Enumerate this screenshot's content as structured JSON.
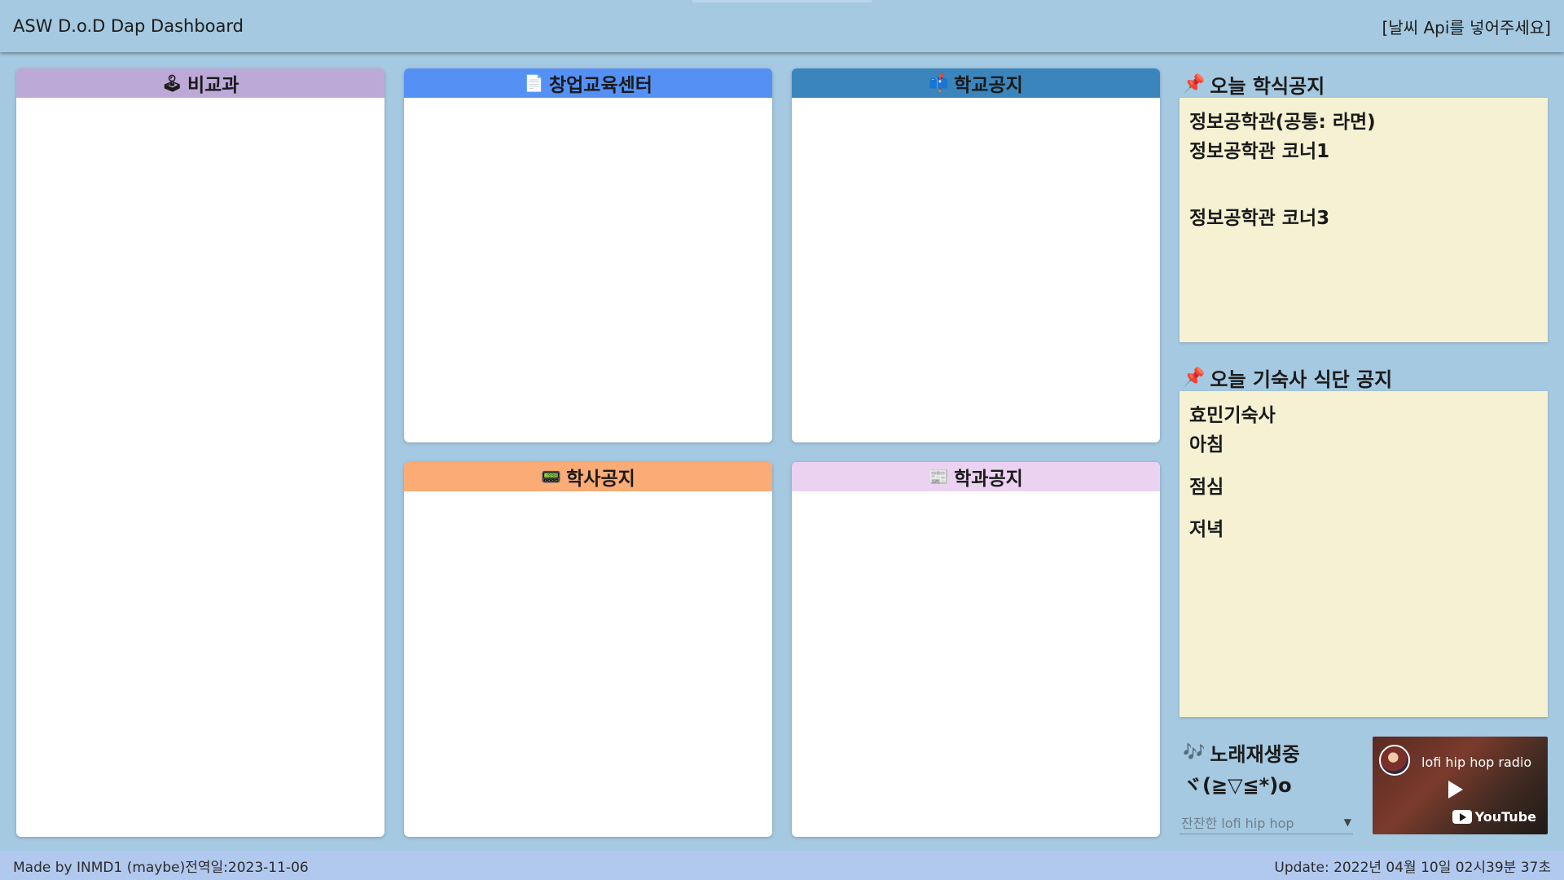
{
  "header": {
    "title": "ASW D.o.D Dap Dashboard",
    "weather": "[날씨 Api를 넣어주세요]"
  },
  "panels": {
    "bigyo": {
      "icon": "🕹",
      "label": "비교과",
      "color": "#bda9d8"
    },
    "startup": {
      "icon": "📄",
      "label": "창업교육센터",
      "color": "#5591f5"
    },
    "school": {
      "icon": "📫",
      "label": "학교공지",
      "color": "#3a86bc"
    },
    "haksa": {
      "icon": "📟",
      "label": "학사공지",
      "color": "#fbab75"
    },
    "dept": {
      "icon": "📰",
      "label": "학과공지",
      "color": "#ebd2f1"
    }
  },
  "cafeteria": {
    "title": "오늘 학식공지",
    "lines": [
      "정보공학관(공통: 라면)",
      "정보공학관 코너1",
      "정보공학관 코너3"
    ]
  },
  "dorm": {
    "title": "오늘 기숙사 식단 공지",
    "lines": [
      "효민기숙사",
      "아침",
      "점심",
      "저녁"
    ]
  },
  "music": {
    "title": "노래재생중",
    "emote": "ヾ(≧▽≦*)o",
    "selected": "잔잔한 lofi hip hop",
    "video_title": "lofi hip hop radio",
    "video_brand": "YouTube"
  },
  "footer": {
    "credit": "Made by INMD1 (maybe)전역일:2023-11-06",
    "update": "Update: 2022년 04월 10일 02시39분 37초"
  },
  "colors": {
    "background": "#a5c9e1",
    "note": "#f5f1d2",
    "footer": "#b2c9ef",
    "pin": "#e0243b"
  }
}
